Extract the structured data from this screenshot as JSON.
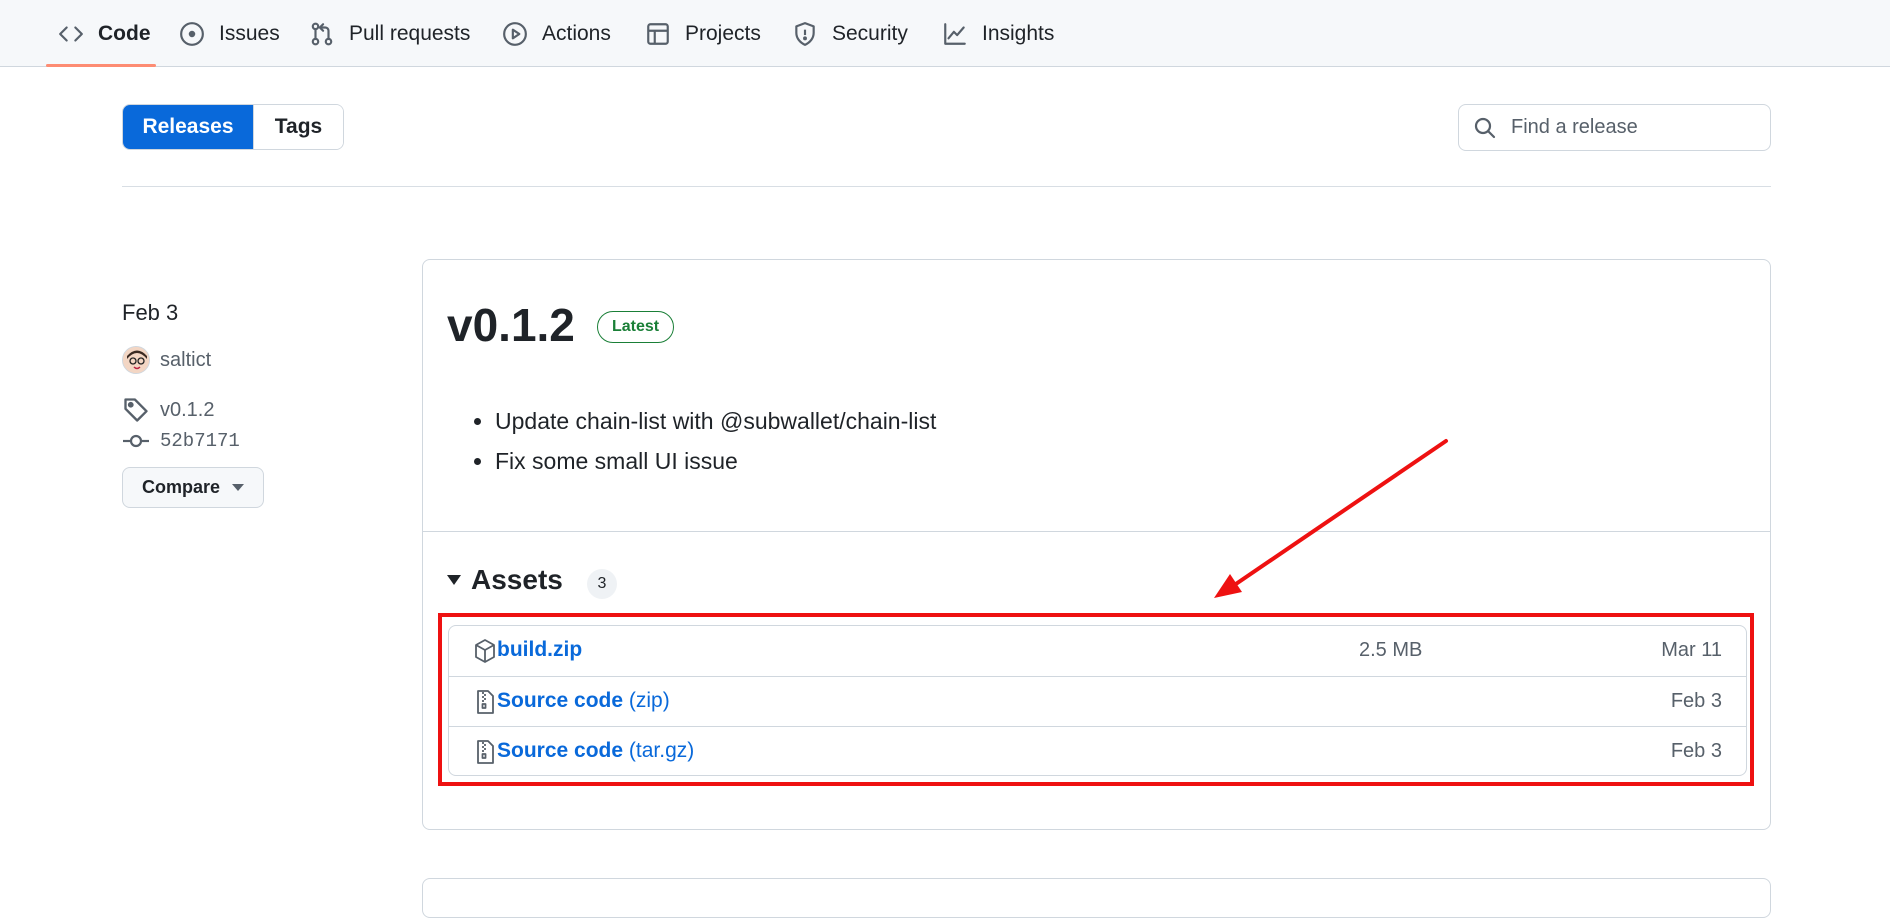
{
  "colors": {
    "accent": "#0969da",
    "latest_badge": "#1a7f37",
    "tab_underline": "#fd8c73",
    "annotation": "#ee1111"
  },
  "repo_nav": {
    "tabs": [
      {
        "label": "Code",
        "icon": "code-icon",
        "active": true
      },
      {
        "label": "Issues",
        "icon": "issue-opened-icon"
      },
      {
        "label": "Pull requests",
        "icon": "git-pull-request-icon"
      },
      {
        "label": "Actions",
        "icon": "play-icon"
      },
      {
        "label": "Projects",
        "icon": "table-icon"
      },
      {
        "label": "Security",
        "icon": "shield-icon"
      },
      {
        "label": "Insights",
        "icon": "graph-icon"
      }
    ]
  },
  "toggle": {
    "releases": "Releases",
    "tags": "Tags",
    "selected": "Releases"
  },
  "search": {
    "placeholder": "Find a release",
    "icon": "search-icon"
  },
  "release": {
    "date": "Feb 3",
    "author": "saltict",
    "tag": "v0.1.2",
    "commit": "52b7171",
    "compare_label": "Compare",
    "title": "v0.1.2",
    "badge": "Latest",
    "notes": [
      "Update chain-list with @subwallet/chain-list",
      "Fix some small UI issue"
    ],
    "assets": {
      "heading": "Assets",
      "count": "3",
      "items": [
        {
          "name": "build.zip",
          "suffix": "",
          "size": "2.5 MB",
          "date": "Mar 11",
          "icon": "package-icon"
        },
        {
          "name": "Source code",
          "suffix": "(zip)",
          "size": "",
          "date": "Feb 3",
          "icon": "file-zip-icon"
        },
        {
          "name": "Source code",
          "suffix": "(tar.gz)",
          "size": "",
          "date": "Feb 3",
          "icon": "file-zip-icon"
        }
      ]
    }
  }
}
